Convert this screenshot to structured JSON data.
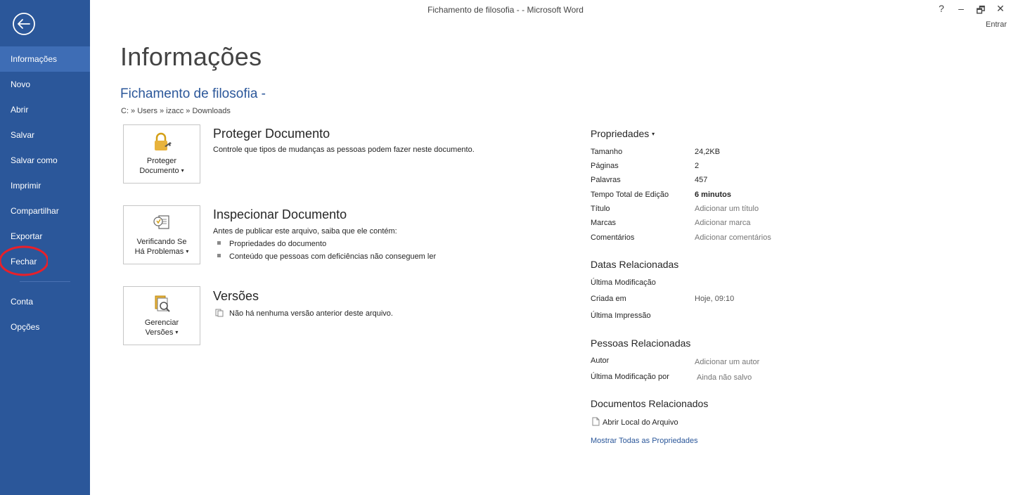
{
  "window": {
    "title": "Fichamento de filosofia  - - Microsoft Word",
    "help": "?",
    "minimize": "–",
    "restore": "🗗",
    "close": "✕",
    "sign_in": "Entrar"
  },
  "sidebar": {
    "items": [
      {
        "label": "Informações"
      },
      {
        "label": "Novo"
      },
      {
        "label": "Abrir"
      },
      {
        "label": "Salvar"
      },
      {
        "label": "Salvar como"
      },
      {
        "label": "Imprimir"
      },
      {
        "label": "Compartilhar"
      },
      {
        "label": "Exportar"
      },
      {
        "label": "Fechar"
      }
    ],
    "footer_items": [
      {
        "label": "Conta"
      },
      {
        "label": "Opções"
      }
    ],
    "accent": "#2b579a",
    "highlight_circle_color": "#e8202a"
  },
  "main": {
    "title": "Informações",
    "doc_title": "Fichamento de filosofia  -",
    "path": "C: » Users » izacc » Downloads",
    "protect": {
      "button_line1": "Proteger",
      "button_line2": "Documento",
      "heading": "Proteger Documento",
      "description": "Controle que tipos de mudanças as pessoas podem fazer neste documento."
    },
    "inspect": {
      "button_line1": "Verificando Se",
      "button_line2": "Há Problemas",
      "heading": "Inspecionar Documento",
      "description": "Antes de publicar este arquivo, saiba que ele contém:",
      "bullets": [
        "Propriedades do documento",
        "Conteúdo que pessoas com deficiências não conseguem ler"
      ]
    },
    "versions": {
      "button_line1": "Gerenciar",
      "button_line2": "Versões",
      "heading": "Versões",
      "description": "Não há nenhuma versão anterior deste arquivo."
    }
  },
  "properties": {
    "heading": "Propriedades",
    "rows": [
      {
        "key": "Tamanho",
        "value": "24,2KB"
      },
      {
        "key": "Páginas",
        "value": "2"
      },
      {
        "key": "Palavras",
        "value": "457"
      },
      {
        "key": "Tempo Total de Edição",
        "value": "6 minutos"
      },
      {
        "key": "Título",
        "value": "Adicionar um título"
      },
      {
        "key": "Marcas",
        "value": "Adicionar marca"
      },
      {
        "key": "Comentários",
        "value": "Adicionar comentários"
      }
    ],
    "dates_heading": "Datas Relacionadas",
    "dates": [
      {
        "key": "Última Modificação",
        "value": ""
      },
      {
        "key": "Criada em",
        "value": "Hoje, 09:10"
      },
      {
        "key": "Última Impressão",
        "value": ""
      }
    ],
    "people_heading": "Pessoas Relacionadas",
    "people": [
      {
        "key": "Autor",
        "value": "Adicionar um autor"
      },
      {
        "key": "Última Modificação por",
        "value": "Ainda não salvo"
      }
    ],
    "docs_heading": "Documentos Relacionados",
    "open_location": "Abrir Local do Arquivo",
    "show_all": "Mostrar Todas as Propriedades"
  }
}
